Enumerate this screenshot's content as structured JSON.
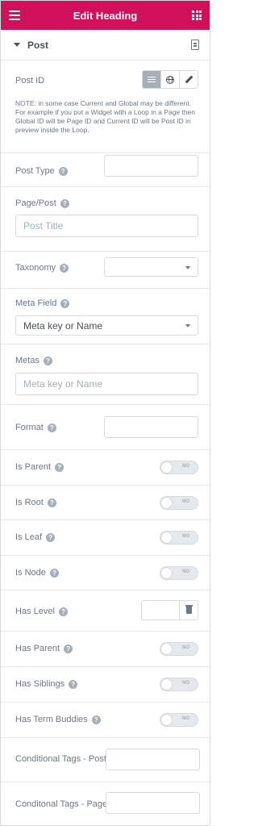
{
  "header": {
    "title": "Edit Heading",
    "menu_icon": "hamburger-icon",
    "apps_icon": "grid-icon"
  },
  "section": {
    "title": "Post",
    "expanded": true,
    "icon": "document-icon"
  },
  "post_id": {
    "label": "Post ID",
    "options": [
      "current-list-icon",
      "global-globe-icon",
      "custom-pencil-icon"
    ],
    "selected": "current-list-icon",
    "note": "NOTE: in some case Current and Global may be different. For example if you put a Widget with a Loop in a Page then Global ID will be Page ID and Current ID will be Post ID in preview inside the Loop."
  },
  "fields": {
    "post_type": {
      "label": "Post Type",
      "value": ""
    },
    "page_post": {
      "label": "Page/Post",
      "placeholder": "Post Title"
    },
    "taxonomy": {
      "label": "Taxonomy",
      "value": ""
    },
    "meta_field": {
      "label": "Meta Field",
      "value": "Meta key or Name"
    },
    "metas": {
      "label": "Metas",
      "placeholder": "Meta key or Name"
    },
    "format": {
      "label": "Format",
      "value": ""
    },
    "is_parent": {
      "label": "Is Parent",
      "state": "NO"
    },
    "is_root": {
      "label": "Is Root",
      "state": "NO"
    },
    "is_leaf": {
      "label": "Is Leaf",
      "state": "NO"
    },
    "is_node": {
      "label": "Is Node",
      "state": "NO"
    },
    "has_level": {
      "label": "Has Level",
      "value": ""
    },
    "has_parent": {
      "label": "Has Parent",
      "state": "NO"
    },
    "has_siblings": {
      "label": "Has Siblings",
      "state": "NO"
    },
    "has_term_buddies": {
      "label": "Has Term Buddies",
      "state": "NO"
    },
    "conditional_tags_post": {
      "label": "Conditional Tags - Post",
      "value": ""
    },
    "conditional_tags_page": {
      "label": "Conditonal Tags - Page",
      "value": ""
    }
  },
  "help_glyph": "?",
  "colors": {
    "accent": "#d0115a",
    "text": "#6d7882",
    "border": "#d5dadf"
  }
}
